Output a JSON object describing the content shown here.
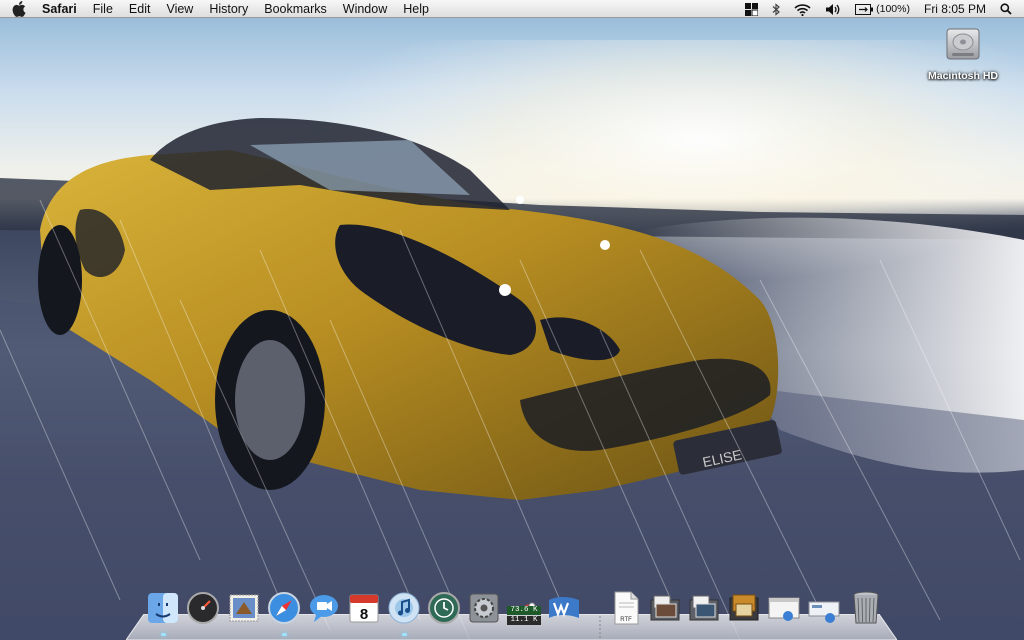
{
  "menubar": {
    "apple_icon": "apple-icon",
    "app_name": "Safari",
    "menus": [
      "File",
      "Edit",
      "View",
      "History",
      "Bookmarks",
      "Window",
      "Help"
    ],
    "status": {
      "battery_percent": "(100%)",
      "clock": "Fri 8:05 PM"
    }
  },
  "desktop": {
    "drive_label": "Macintosh HD",
    "wallpaper_badge_text": "ELISE"
  },
  "dock": {
    "calendar_day": "8",
    "network_up": "73.6 K",
    "network_down": "11.1 K",
    "rtf_label": "RTF"
  }
}
